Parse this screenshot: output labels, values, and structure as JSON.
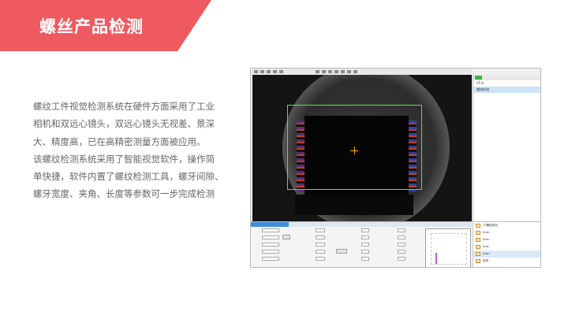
{
  "header": {
    "title": "螺丝产品检测",
    "accent_color": "#ee5a5f"
  },
  "description": {
    "lines": [
      "螺纹工件视觉检测系统在硬件方面采用了工业",
      "相机和双远心镜头，双远心镜头无视差、景深",
      "大、精度高，已在高精密测量方面被应用。",
      "该螺纹检测系统采用了智能视觉软件，操作简",
      "单快捷，软件内置了螺纹检测工具，螺牙间隙、",
      "螺牙宽度、夹角、长度等参数可一步完成检测"
    ]
  },
  "screenshot": {
    "right_panel_rows": [
      "CF.m",
      "螺纹检测"
    ],
    "roi_color": "#5de04a",
    "tools": [
      "CT螺纹检测",
      "Scan",
      "Scan",
      "Scan",
      "Scan",
      "检测"
    ]
  }
}
